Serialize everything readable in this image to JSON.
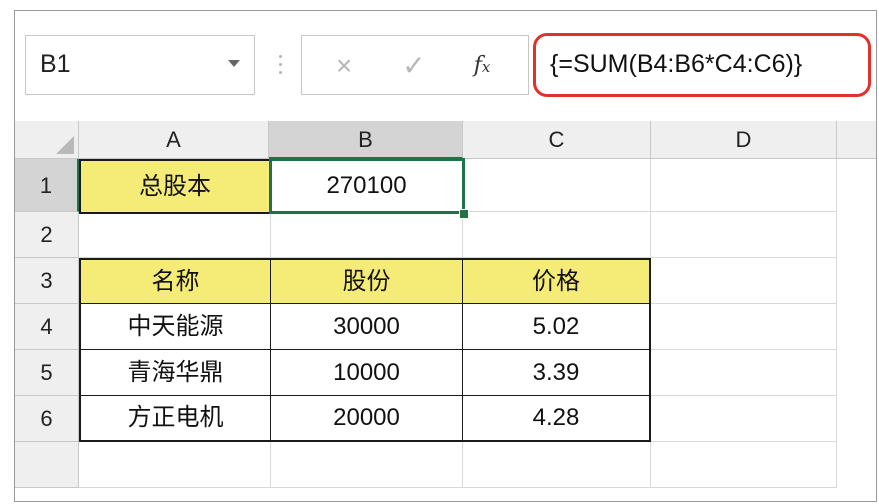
{
  "formula_bar": {
    "name_box": "B1",
    "cancel_glyph": "×",
    "enter_glyph": "✓",
    "fx_label": "fx",
    "formula": "{=SUM(B4:B6*C4:C6)}"
  },
  "columns": [
    "A",
    "B",
    "C",
    "D"
  ],
  "rows": [
    "1",
    "2",
    "3",
    "4",
    "5",
    "6"
  ],
  "cells": {
    "A1": "总股本",
    "B1": "270100",
    "A3": "名称",
    "B3": "股份",
    "C3": "价格",
    "A4": "中天能源",
    "B4": "30000",
    "C4": "5.02",
    "A5": "青海华鼎",
    "B5": "10000",
    "C5": "3.39",
    "A6": "方正电机",
    "B6": "20000",
    "C6": "4.28"
  },
  "colors": {
    "highlight_yellow": "#f5ec78",
    "selection_green": "#217346",
    "callout_red": "#e0312b"
  },
  "selected_cell": "B1"
}
